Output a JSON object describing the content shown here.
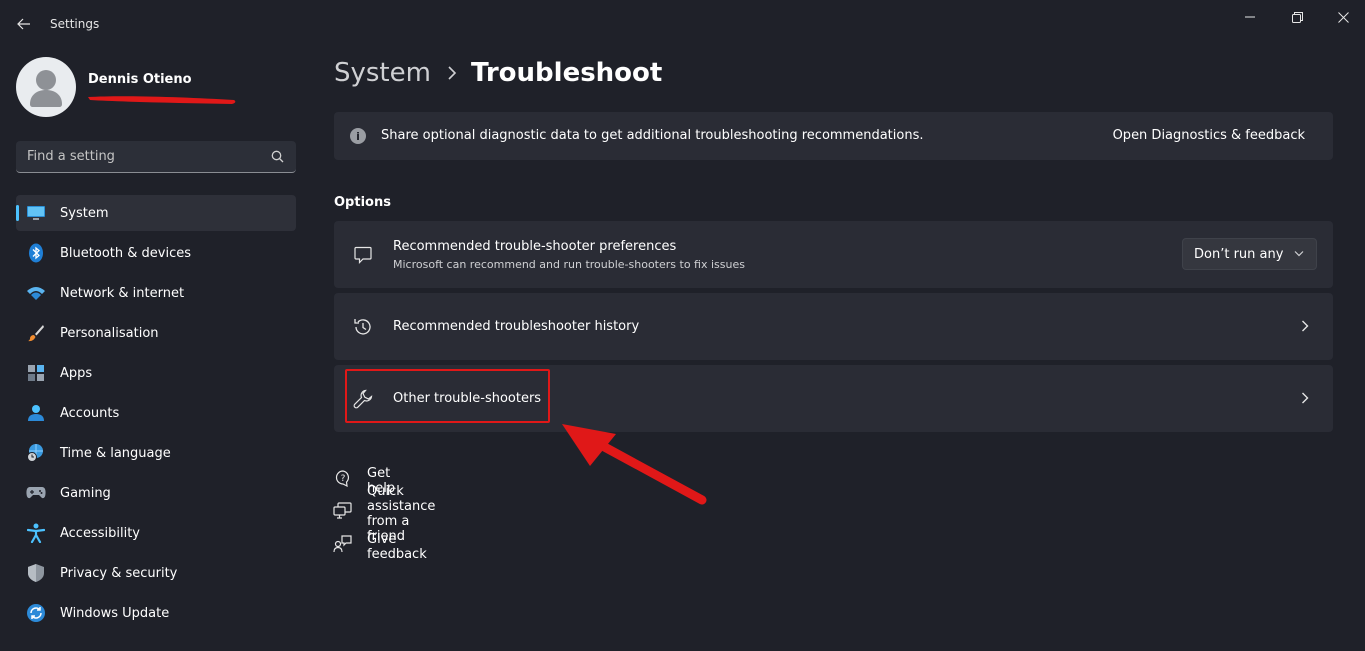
{
  "window": {
    "title": "Settings"
  },
  "profile": {
    "name": "Dennis Otieno"
  },
  "search": {
    "placeholder": "Find a setting"
  },
  "sidebar": {
    "items": [
      {
        "label": "System",
        "icon": "monitor-icon",
        "selected": true
      },
      {
        "label": "Bluetooth & devices",
        "icon": "bluetooth-icon"
      },
      {
        "label": "Network & internet",
        "icon": "wifi-icon"
      },
      {
        "label": "Personalisation",
        "icon": "brush-icon"
      },
      {
        "label": "Apps",
        "icon": "apps-icon"
      },
      {
        "label": "Accounts",
        "icon": "person-icon"
      },
      {
        "label": "Time & language",
        "icon": "globe-clock-icon"
      },
      {
        "label": "Gaming",
        "icon": "gamepad-icon"
      },
      {
        "label": "Accessibility",
        "icon": "accessibility-icon"
      },
      {
        "label": "Privacy & security",
        "icon": "shield-icon"
      },
      {
        "label": "Windows Update",
        "icon": "update-icon"
      }
    ]
  },
  "breadcrumb": {
    "parent": "System",
    "current": "Troubleshoot"
  },
  "info_bar": {
    "text": "Share optional diagnostic data to get additional troubleshooting recommendations.",
    "link": "Open Diagnostics & feedback"
  },
  "options": {
    "heading": "Options",
    "cards": [
      {
        "title": "Recommended trouble-shooter preferences",
        "description": "Microsoft can recommend and run trouble-shooters to fix issues",
        "dropdown_value": "Don’t run any",
        "icon": "chat-icon"
      },
      {
        "title": "Recommended troubleshooter history",
        "icon": "history-icon"
      },
      {
        "title": "Other trouble-shooters",
        "icon": "wrench-icon"
      }
    ]
  },
  "help_links": [
    {
      "label": "Get help",
      "icon": "help-icon"
    },
    {
      "label": "Quick assistance from a friend",
      "icon": "remote-assist-icon"
    },
    {
      "label": "Give feedback",
      "icon": "feedback-icon"
    }
  ],
  "colors": {
    "background": "#1f2129",
    "card": "#2a2c35",
    "accent": "#4cc2ff",
    "annotation": "#e01818"
  }
}
